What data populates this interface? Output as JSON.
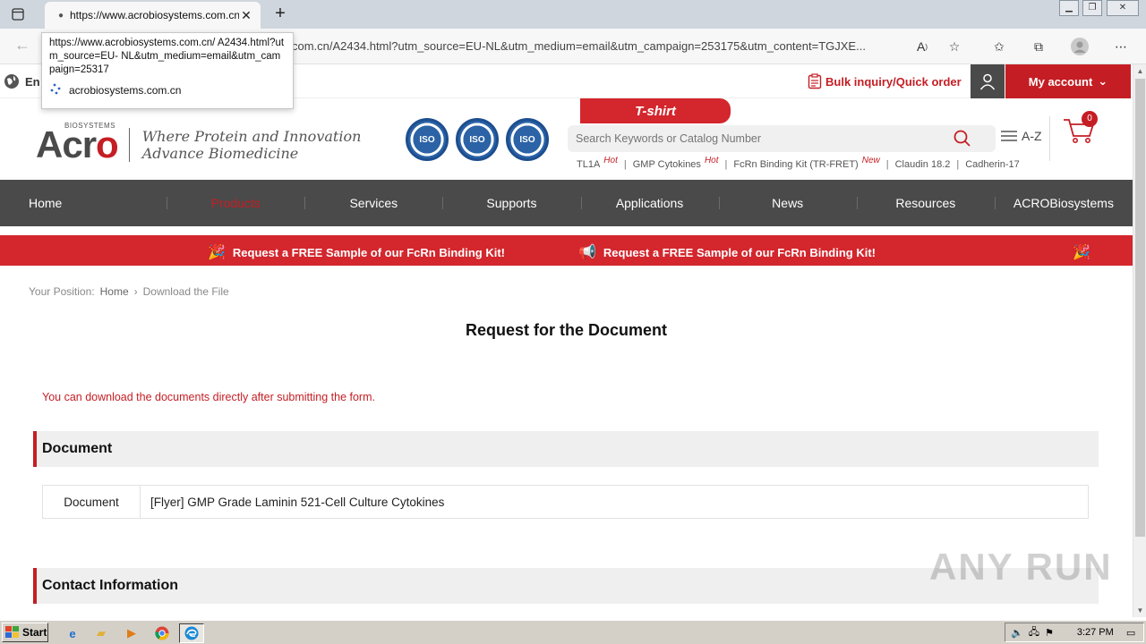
{
  "browser": {
    "tab_title": "https://www.acrobiosystems.com.cn/A2434.html?utm_source=EU-NL",
    "url_rest": "com.cn/A2434.html?utm_source=EU-NL&utm_medium=email&utm_campaign=253175&utm_content=TGJXE...",
    "tooltip_url": "https://www.acrobiosystems.com.cn/ A2434.html?utm_source=EU- NL&utm_medium=email&utm_campaign=25317",
    "tooltip_host": "acrobiosystems.com.cn"
  },
  "topbar": {
    "language": "En",
    "bulk": "Bulk inquiry/Quick order",
    "account": "My account"
  },
  "header": {
    "logo_small": "BIOSYSTEMS",
    "logo_left": "Acr",
    "logo_right": "o",
    "slogan_line1": "Where Protein and Innovation",
    "slogan_line2": "Advance Biomedicine",
    "iso_labels": [
      "ISO",
      "ISO",
      "ISO"
    ],
    "promo": "T-shirt",
    "search_placeholder": "Search Keywords or Catalog Number",
    "az_label": "A-Z",
    "cart_count": "0",
    "hot_links": [
      {
        "label": "TL1A",
        "tag": "Hot"
      },
      {
        "label": "GMP Cytokines",
        "tag": "Hot"
      },
      {
        "label": "FcRn Binding Kit (TR-FRET)",
        "tag": "New"
      },
      {
        "label": "Claudin 18.2",
        "tag": ""
      },
      {
        "label": "Cadherin-17",
        "tag": ""
      }
    ]
  },
  "nav": [
    "Home",
    "Products",
    "Services",
    "Supports",
    "Applications",
    "News",
    "Resources",
    "ACROBiosystems"
  ],
  "banner": {
    "msg1": "Request a FREE Sample of our FcRn Binding Kit!",
    "msg2": "Request a FREE Sample of our FcRn Binding Kit!"
  },
  "breadcrumb": {
    "label": "Your Position:",
    "home": "Home",
    "current": "Download the File"
  },
  "page": {
    "title": "Request for the Document",
    "notice": "You can download the documents directly after submitting the form.",
    "document_section": "Document",
    "doc_label": "Document",
    "doc_value": "[Flyer] GMP Grade Laminin 521-Cell Culture Cytokines",
    "contact_section": "Contact Information"
  },
  "watermark": "ANY RUN",
  "taskbar": {
    "start": "Start",
    "time": "3:27 PM"
  }
}
